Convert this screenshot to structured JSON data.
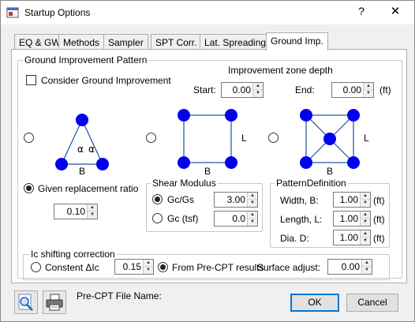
{
  "window": {
    "title": "Startup Options",
    "help_label": "?",
    "close_label": "✕"
  },
  "tabs": [
    "EQ & GW",
    "Methods",
    "Sampler",
    "SPT Corr.",
    "Lat. Spreading",
    "Ground Imp."
  ],
  "active_tab_index": 5,
  "pattern": {
    "group_title": "Ground Improvement Pattern",
    "consider_label": "Consider Ground Improvement",
    "consider_checked": false,
    "zone_depth_title": "Improvement zone depth",
    "start_label": "Start:",
    "start_value": "0.00",
    "end_label": "End:",
    "end_value": "0.00",
    "end_unit": "(ft)",
    "selected_pattern": 1,
    "triangle": {
      "alpha1": "α",
      "alpha2": "α",
      "b_label": "B"
    },
    "square": {
      "l_label": "L",
      "b_label": "B"
    },
    "square_center": {
      "l_label": "L",
      "b_label": "B"
    },
    "given_ratio_label": "Given replacement ratio",
    "given_ratio_selected": true,
    "ratio_value": "0.10"
  },
  "shear": {
    "title": "Shear Modulus",
    "gcgs_label": "Gc/Gs",
    "gcgs_value": "3.00",
    "gcgs_selected": true,
    "gc_label": "Gc (tsf)",
    "gc_value": "0.0",
    "gc_selected": false
  },
  "pattern_def": {
    "title": "PatternDefinition",
    "width_label": "Width, B:",
    "width_value": "1.00",
    "width_unit": "(ft)",
    "length_label": "Length, L:",
    "length_value": "1.00",
    "length_unit": "(ft)",
    "dia_label": "Dia. D:",
    "dia_value": "1.00",
    "dia_unit": "(ft)"
  },
  "ic_shift": {
    "title": "Ic shifting correction",
    "constant_label": "Constent ΔIc",
    "constant_value": "0.15",
    "constant_selected": false,
    "from_pre_label": "From Pre-CPT results",
    "from_pre_selected": true,
    "surface_label": "Surface adjust:",
    "surface_value": "0.00"
  },
  "footer": {
    "precpt_label": "Pre-CPT File Name:",
    "ok_label": "OK",
    "cancel_label": "Cancel",
    "icons": [
      "open-file-icon",
      "printer-icon"
    ]
  },
  "colors": {
    "pile_fill": "#0000ee",
    "line": "#1f4fa0",
    "focus": "#0078d7"
  }
}
